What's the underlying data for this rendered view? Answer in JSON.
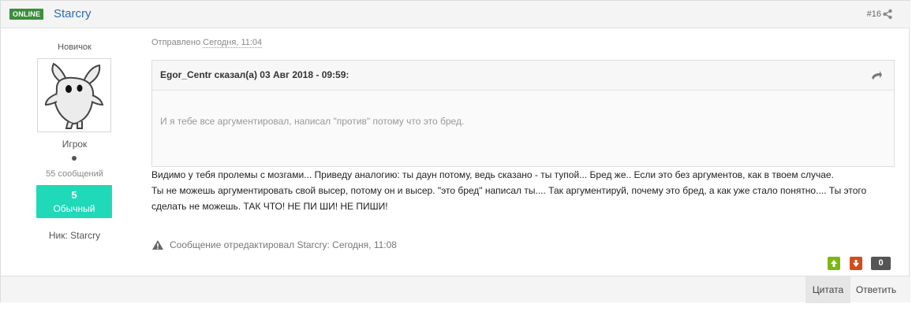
{
  "header": {
    "online_label": "ONLINE",
    "author": "Starcry",
    "post_number": "#16"
  },
  "author_panel": {
    "group": "Новичок",
    "rank": "Игрок",
    "post_count": "55 сообщений",
    "reputation_value": "5",
    "reputation_label": "Обычный",
    "nick": "Ник: Starcry"
  },
  "post": {
    "posted_prefix": "Отправлено",
    "posted_date": "Сегодня, 11:04",
    "quote_citation": "Egor_Centr сказал(а) 03 Авг 2018 - 09:59:",
    "quote_text": "И я тебе все аргументировал, написал \"против\" потому что это бред.",
    "body_lines": [
      "Видимо у тебя пролемы с мозгами... Приведу аналогию: ты даун потому, ведь сказано - ты тупой... Бред же.. Если это без аргументов, как в твоем случае.",
      "Ты не можешь аргументировать свой высер, потому он и высер. \"это бред\" написал ты.... Так аргументируй, почему это бред, а как уже стало понятно.... Ты этого",
      "сделать не можешь. ТАК ЧТО! НЕ ПИ ШИ! НЕ ПИШИ!"
    ],
    "edit_note": "Сообщение отредактировал Starcry: Сегодня, 11:08",
    "reputation_count": "0"
  },
  "footer": {
    "quote_button": "Цитата",
    "reply_button": "Ответить"
  },
  "icons": {
    "share": "share-icon",
    "quote_jump": "quote-jump-icon",
    "warning": "warning-icon",
    "vote_up": "arrow-up-icon",
    "vote_down": "arrow-down-icon"
  },
  "colors": {
    "online_badge": "#3a8f3a",
    "author_link": "#2a6bb0",
    "reputation_box": "#20d9b9",
    "vote_up": "#7cb814",
    "vote_down": "#d34d1c"
  }
}
